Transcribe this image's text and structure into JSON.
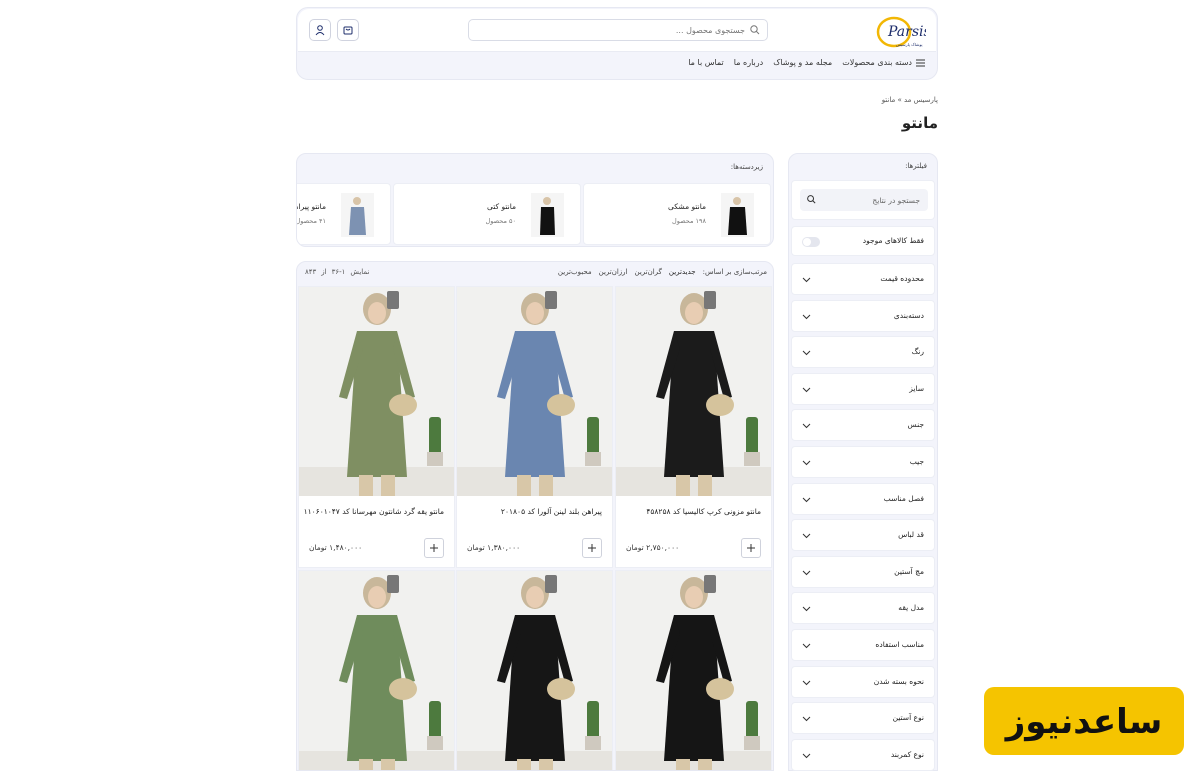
{
  "header": {
    "logo_text": "Parsis",
    "logo_subtext": "پوشاک پارسیس",
    "search_placeholder": "جستجوی محصول ...",
    "nav": [
      "دسته بندی محصولات",
      "مجله مد و پوشاک",
      "درباره ما",
      "تماس با ما"
    ]
  },
  "breadcrumb": "پارسیس مد » مانتو",
  "page_title": "مانتو",
  "filters": {
    "label": "فیلترها:",
    "search_placeholder": "جستجو در نتایج",
    "in_stock_label": "فقط کالاهای موجود",
    "items": [
      "محدوده قیمت",
      "دسته‌بندی",
      "رنگ",
      "سایز",
      "جنس",
      "جیب",
      "فصل مناسب",
      "قد لباس",
      "مچ آستین",
      "مدل یقه",
      "مناسب استفاده",
      "نحوه بسته شدن",
      "نوع آستین",
      "نوع کمربند"
    ]
  },
  "subcategories": {
    "label": "زیردسته‌ها:",
    "items": [
      {
        "name": "مانتو مشکی",
        "count": "۱۹۸ محصول"
      },
      {
        "name": "مانتو کتی",
        "count": "۵۰ محصول"
      },
      {
        "name": "مانتو پیراهنی",
        "count": "۴۱ محصول"
      }
    ]
  },
  "sortbar": {
    "label": "مرتب‌سازی بر اساس:",
    "options": [
      "جدیدترین",
      "گران‌ترین",
      "ارزان‌ترین",
      "محبوب‌ترین"
    ],
    "showing_label": "نمایش",
    "showing_range": "۳۶-۱",
    "of_label": "از",
    "total": "۸۴۳"
  },
  "products": [
    {
      "title": "مانتو مزونی کرپ کالیسیا کد ۴۵۸۲۵۸",
      "price": "۲,۷۵۰,۰۰۰ تومان",
      "color": "#1b1b1b"
    },
    {
      "title": "پیراهن بلند لینن آلورا کد ۲۰۱۸۰۵",
      "price": "۱,۳۸۰,۰۰۰ تومان",
      "color": "#6a86b0"
    },
    {
      "title": "مانتو یقه گرد شانتون مهرسانا کد ۱۱۰۶۰۱۰۴۷",
      "price": "۱,۴۸۰,۰۰۰ تومان",
      "color": "#7f8f62"
    },
    {
      "color": "#151515"
    },
    {
      "color": "#161616"
    },
    {
      "color": "#6f8c5c"
    }
  ],
  "watermark": "ساعدنیوز"
}
